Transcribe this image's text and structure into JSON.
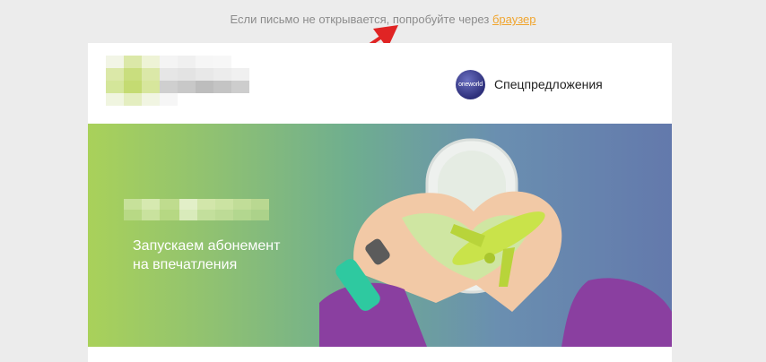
{
  "notice": {
    "text": "Если письмо не открывается, попробуйте через",
    "link_label": "браузер"
  },
  "header": {
    "oneworld_badge_text": "oneworld",
    "promo_label": "Спецпредложения"
  },
  "banner": {
    "headline_line1": "Запускаем абонемент",
    "headline_line2": "на впечатления"
  },
  "colors": {
    "page_bg": "#ececec",
    "link_color": "#f0a52e",
    "arrow_color": "#e02424",
    "banner_gradient_start": "#a9d15a",
    "banner_gradient_end": "#6379ac",
    "sleeve_color": "#8a3fa0",
    "watch_band_color": "#2ec9a0",
    "airplane_color": "#c9e34a"
  },
  "icons": {
    "arrow": "red-arrow-icon",
    "oneworld": "oneworld-logo-icon",
    "brand_logo": "pixelated-logo"
  }
}
